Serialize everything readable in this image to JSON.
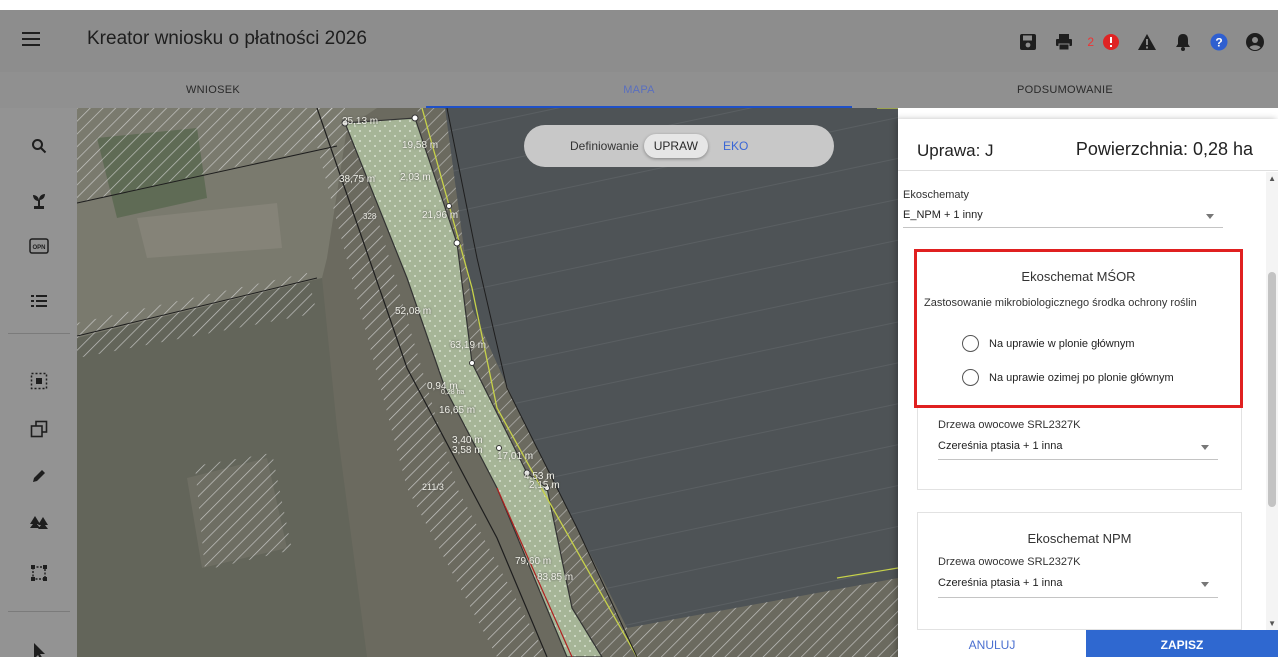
{
  "header": {
    "title": "Kreator wniosku o płatności 2026",
    "notification_count": "2"
  },
  "tabs": [
    {
      "label": "WNIOSEK"
    },
    {
      "label": "MAPA"
    },
    {
      "label": "PODSUMOWANIE"
    }
  ],
  "map": {
    "toggle": {
      "prefix": "Definiowanie",
      "option_active": "UPRAW",
      "option_other": "EKO"
    },
    "labels": [
      "25,13 m",
      "19,58 m",
      "38,75 m",
      "2,03 m",
      "21,96 m",
      "52,08 m",
      "63,19 m",
      "0,94 m",
      "0,28 ha",
      "16,65 m",
      "3,40 m",
      "3,58 m",
      "17,01 m",
      "4,53 m",
      "2,15 m",
      "79,60 m",
      "83,85 m",
      "211/3",
      "328"
    ]
  },
  "panel": {
    "crop_label": "Uprawa: J",
    "area_label": "Powierzchnia: 0,28 ha",
    "ekoschematy": {
      "label": "Ekoschematy",
      "value": "E_NPM + 1 inny"
    },
    "msor": {
      "title": "Ekoschemat MŚOR",
      "question": "Zastosowanie mikrobiologicznego środka ochrony roślin",
      "options": [
        "Na uprawie w plonie głównym",
        "Na uprawie ozimej po plonie głównym"
      ]
    },
    "msor_trees": {
      "label": "Drzewa owocowe SRL2327K",
      "value": "Czereśnia ptasia + 1 inna"
    },
    "npm": {
      "title": "Ekoschemat NPM",
      "label": "Drzewa owocowe SRL2327K",
      "value": "Czereśnia ptasia + 1 inna"
    },
    "buttons": {
      "cancel": "ANULUJ",
      "save": "ZAPISZ"
    }
  },
  "colors": {
    "accent": "#2f68d0",
    "highlight_border": "#e02020",
    "header": "#8d8d8d"
  }
}
